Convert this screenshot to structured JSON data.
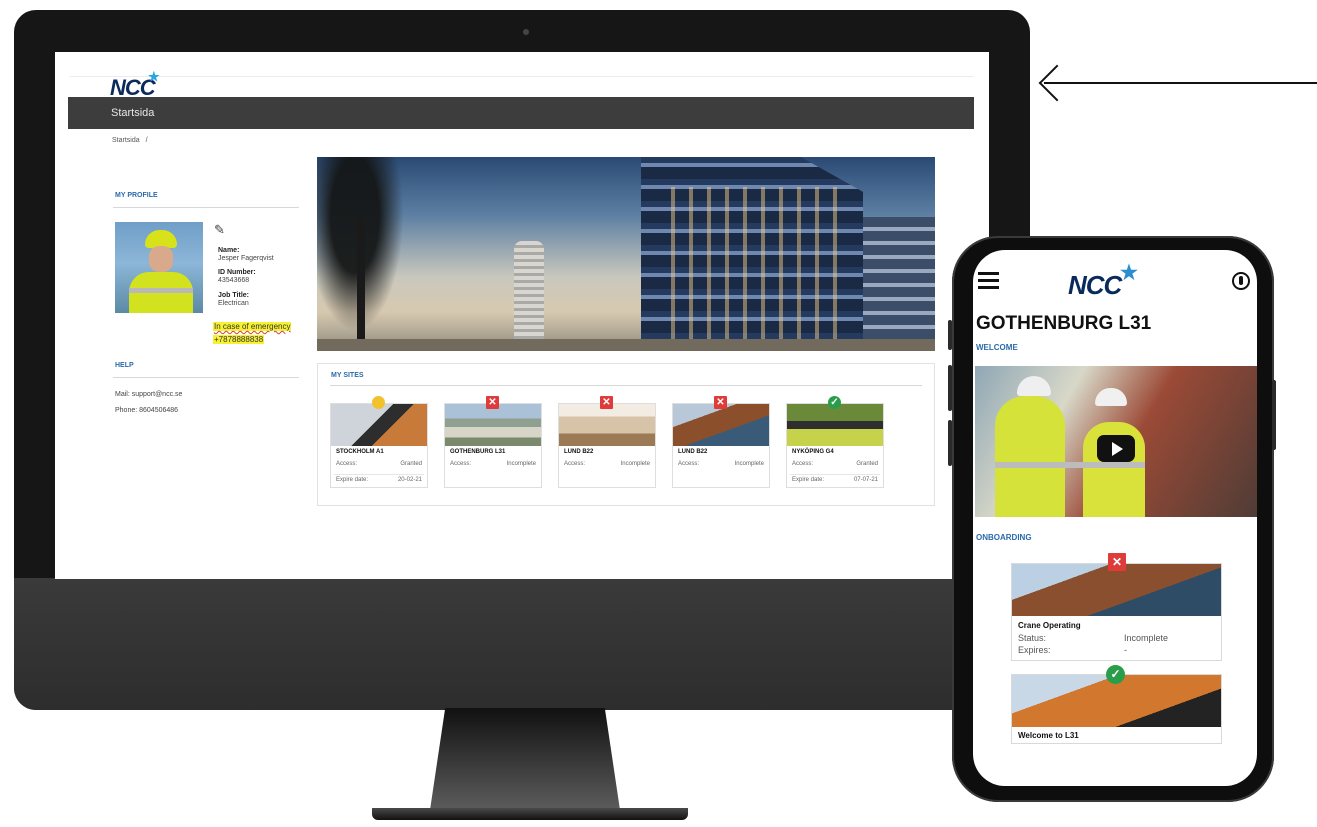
{
  "desktop": {
    "brand": "NCC",
    "nav_title": "Startsida",
    "breadcrumb": {
      "item": "Startsida",
      "separator": "/"
    },
    "profile": {
      "section_title": "MY PROFILE",
      "name_label": "Name:",
      "name_value": "Jesper Fagerqvist",
      "id_label": "ID Number:",
      "id_value": "43543668",
      "job_label": "Job Title:",
      "job_value": "Electrican",
      "emergency_label": "In case of emergency",
      "emergency_phone": "+7878888838"
    },
    "help": {
      "section_title": "HELP",
      "mail": "Mail: support@ncc.se",
      "phone": "Phone: 8604506486"
    },
    "sites": {
      "section_title": "MY SITES",
      "access_label": "Access:",
      "expire_label": "Expire date:",
      "items": [
        {
          "name": "STOCKHOLM A1",
          "access": "Granted",
          "expire": "20-02-21",
          "status": "warning"
        },
        {
          "name": "GOTHENBURG L31",
          "access": "Incomplete",
          "status": "incomplete"
        },
        {
          "name": "LUND B22",
          "access": "Incomplete",
          "status": "incomplete"
        },
        {
          "name": "LUND B22",
          "access": "Incomplete",
          "status": "incomplete"
        },
        {
          "name": "NYKÖPING G4",
          "access": "Granted",
          "expire": "07-07-21",
          "status": "complete"
        }
      ]
    }
  },
  "mobile": {
    "brand": "NCC",
    "site_title": "GOTHENBURG L31",
    "welcome_title": "WELCOME",
    "onboarding_title": "ONBOARDING",
    "cards": [
      {
        "title": "Crane Operating",
        "status_label": "Status:",
        "status_value": "Incomplete",
        "expires_label": "Expires:",
        "expires_value": "-",
        "badge": "incomplete"
      },
      {
        "title": "Welcome to L31",
        "badge": "complete"
      }
    ]
  },
  "icons": {
    "check": "✓",
    "cross": "✕",
    "pencil": "✎",
    "star": "★"
  },
  "colors": {
    "brand_navy": "#0a2a5c",
    "brand_blue": "#2a8ed0",
    "section_blue": "#2b6aa8",
    "navbar": "#3d3d3d",
    "status_incomplete": "#e03b3b",
    "status_complete": "#2a9d4b",
    "highlight": "#f6f233"
  }
}
